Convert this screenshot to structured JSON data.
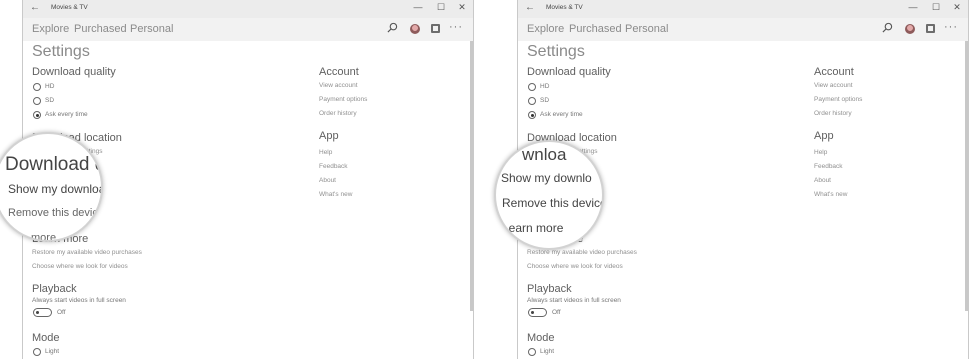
{
  "app": {
    "title": "Movies & TV",
    "back_glyph": "←",
    "window_buttons": [
      "—",
      "☐",
      "✕"
    ],
    "nav_tabs": [
      "Explore",
      "Purchased",
      "Personal"
    ],
    "more_glyph": "···"
  },
  "settings": {
    "heading": "Settings",
    "download_quality": {
      "heading": "Download quality",
      "options": [
        "HD",
        "SD",
        "Ask every time"
      ],
      "selected": "Ask every time"
    },
    "download_location": {
      "heading": "Download location",
      "link": "Change storage settings"
    },
    "learn_more": {
      "heading": "Learn more",
      "links": [
        "Restore my available video purchases",
        "Choose where we look for videos"
      ]
    },
    "playback": {
      "heading": "Playback",
      "label": "Always start videos in full screen",
      "toggle_state": "Off"
    },
    "mode": {
      "heading": "Mode",
      "option": "Light"
    }
  },
  "sidebar": {
    "account": {
      "heading": "Account",
      "links": [
        "View account",
        "Payment options",
        "Order history"
      ]
    },
    "app_section": {
      "heading": "App",
      "links": [
        "Help",
        "Feedback",
        "About",
        "What's new"
      ]
    }
  },
  "magnifier_left": {
    "heading": "Download de",
    "items": [
      "Show my download",
      "Remove this device"
    ],
    "partial_bottom": "more"
  },
  "magnifier_right": {
    "heading": "wnloa",
    "items": [
      "Show my downlo",
      "Remove this device",
      "Learn more"
    ]
  },
  "colors": {
    "titlebar": "#ececec",
    "navbar": "#f2f2f2",
    "text": "#5f5f5f",
    "link": "#909090"
  }
}
